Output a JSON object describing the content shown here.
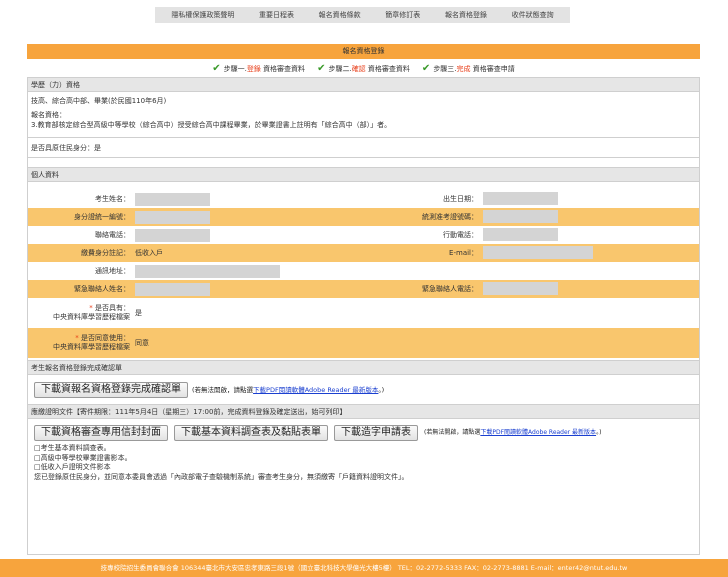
{
  "topnav": [
    "隱私權保護政策聲明",
    "重要日程表",
    "報名資格條款",
    "簡章修訂表",
    "報名資格登錄",
    "收件狀態查詢"
  ],
  "title": "報名資格登錄",
  "steps": [
    {
      "prefix": "步驟一.",
      "highlight": "登錄",
      "suffix": "資格審查資料"
    },
    {
      "prefix": "步驟二.",
      "highlight": "確認",
      "suffix": "資格審查資料"
    },
    {
      "prefix": "步驟三.",
      "highlight": "完成",
      "suffix": "資格審查申請"
    }
  ],
  "education": {
    "header": "學歷（力）資格",
    "line1": "技高、綜合高中部、畢業(於民國110年6月)",
    "line2": "報名資格：",
    "line3": "3.教育部核定綜合型高級中等學校（綜合高中）授受綜合高中課程畢業，於畢業證書上註明有「綜合高中（部）」者。"
  },
  "aboriginal": "是否具原住民身分：是",
  "personal": {
    "header": "個人資料",
    "name_label": "考生姓名：",
    "birth_label": "出生日期：",
    "id_label": "身分證統一編號：",
    "unified_label": "統測准考證號碼：",
    "phone_label": "聯絡電話：",
    "mobile_label": "行動電話：",
    "fee_label": "繳費身分註記：",
    "fee_value": "低收入戶",
    "email_label": "E-mail：",
    "address_label": "通訊地址：",
    "emergency_name_label": "緊急聯絡人姓名：",
    "emergency_phone_label": "緊急聯絡人電話：",
    "portfolio_label_1": "是否具有：",
    "portfolio_label_2": "中央資料庫學習歷程檔案",
    "portfolio_value": "是",
    "consent_label_1": "是否同意使用：",
    "consent_label_2": "中央資料庫學習歷程檔案",
    "consent_value": "同意"
  },
  "confirm": {
    "header": "考生報名資格登錄完成確認單",
    "button": "下載資報名資格登錄完成確認單",
    "note_prefix": "(若無法開啟，請點選",
    "note_link": "下載PDF閱讀軟體Adobe Reader 最新版本",
    "note_suffix": "。)"
  },
  "documents": {
    "header": "應繳證明文件【寄件期限：111年5月4日（星期三）17:00前，完成資料登錄及確定送出，始可列印】",
    "btn_envelope": "下載資格審查專用信封封面",
    "btn_survey": "下載基本資料調查表及黏貼表單",
    "btn_reprint": "下載造字申請表",
    "note_prefix": "(若無法開啟，請點選",
    "note_link": "下載PDF閱讀軟體Adobe Reader 最新版本",
    "note_suffix": "。)",
    "items": [
      "□考生基本資料調查表。",
      "□高級中等學校畢業證書影本。",
      "□低收入戶證明文件影本"
    ],
    "final_note": "您已登錄原住民身分，並同意本委員會透過「內政部電子查驗機制系統」審查考生身分，無須繳寄「戶籍資料證明文件」。"
  },
  "footer": "技專校院招生委員會聯合會 106344臺北市大安區忠孝東路三段1號（國立臺北科技大學億光大樓5樓） TEL：02-2772-5333 FAX：02-2773-8881 E-mail：enter42@ntut.edu.tw"
}
